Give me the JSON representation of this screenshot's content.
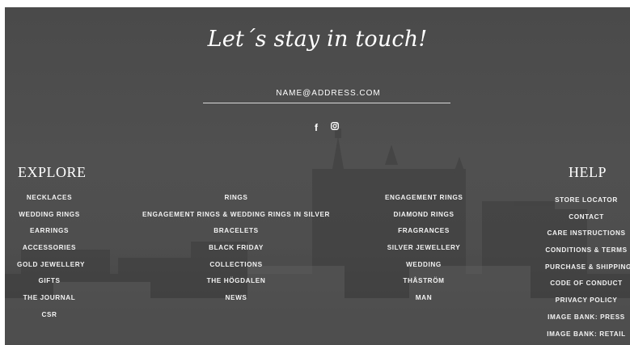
{
  "newsletter": {
    "title": "Let´s stay in touch!",
    "email_placeholder": "NAME@ADDRESS.COM"
  },
  "social": {
    "facebook_glyph": "f",
    "icons": [
      "facebook-icon",
      "instagram-icon"
    ]
  },
  "explore": {
    "heading": "EXPLORE",
    "col1": [
      "NECKLACES",
      "WEDDING RINGS",
      "EARRINGS",
      "ACCESSORIES",
      "GOLD JEWELLERY",
      "GIFTS",
      "THE JOURNAL",
      "CSR"
    ],
    "col2": [
      "RINGS",
      "ENGAGEMENT RINGS & WEDDING RINGS IN SILVER",
      "BRACELETS",
      "BLACK FRIDAY",
      "COLLECTIONS",
      "THE HÖGDALEN",
      "NEWS"
    ],
    "col3": [
      "ENGAGEMENT RINGS",
      "DIAMOND RINGS",
      "FRAGRANCES",
      "SILVER JEWELLERY",
      "WEDDING",
      "THÅSTRÖM",
      "MAN"
    ]
  },
  "help": {
    "heading": "HELP",
    "links": [
      "STORE LOCATOR",
      "CONTACT",
      "CARE INSTRUCTIONS",
      "CONDITIONS & TERMS",
      "PURCHASE & SHIPPING",
      "CODE OF CONDUCT",
      "PRIVACY POLICY",
      "IMAGE BANK: PRESS",
      "IMAGE BANK: RETAIL"
    ]
  },
  "colors": {
    "background": "#4e4e4e",
    "text": "#ffffff"
  }
}
